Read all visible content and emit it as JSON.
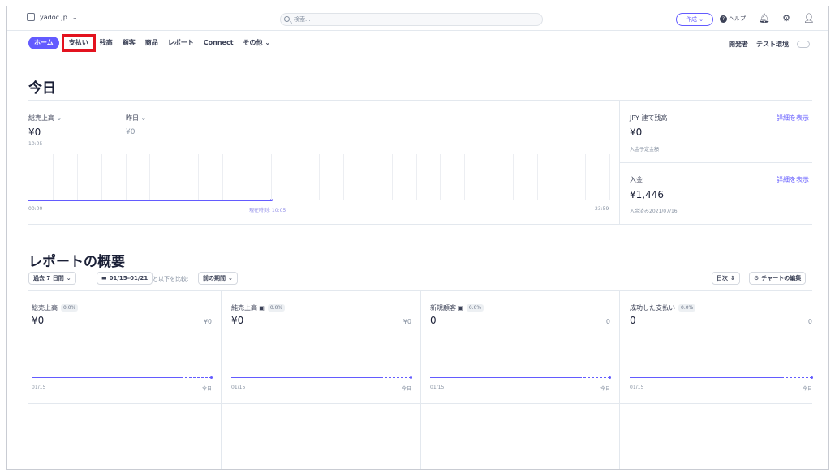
{
  "topbar": {
    "account": "yadoc.jp",
    "search_placeholder": "検索...",
    "create_label": "作成",
    "help_label": "ヘルプ"
  },
  "nav": {
    "items": [
      "ホーム",
      "支払い",
      "残高",
      "顧客",
      "商品",
      "レポート",
      "Connect",
      "その他"
    ],
    "developer": "開発者",
    "test_mode": "テスト環境"
  },
  "today": {
    "title": "今日",
    "gross_label": "総売上高",
    "gross_value": "¥0",
    "gross_time": "10:05",
    "yesterday_label": "昨日",
    "yesterday_value": "¥0",
    "axis_start": "00:00",
    "axis_now": "現在時刻: 10:05",
    "axis_end": "23:59",
    "balance_label": "JPY 建て残高",
    "balance_link": "詳細を表示",
    "balance_value": "¥0",
    "balance_sub": "入金予定金額",
    "payout_label": "入金",
    "payout_link": "詳細を表示",
    "payout_value": "¥1,446",
    "payout_sub": "入金済み2021/07/16"
  },
  "report": {
    "title": "レポートの概要",
    "range_label": "過去 7 日間",
    "dates_label": "01/15–01/21",
    "compare_text": "と以下を比較:",
    "compare_label": "前の期間",
    "interval_label": "日次",
    "edit_label": "チャートの編集",
    "cards": [
      {
        "label": "総売上高",
        "chip": "0.0%",
        "value": "¥0",
        "prev": "¥0",
        "start": "01/15",
        "end": "今日"
      },
      {
        "label": "純売上高",
        "chip": "0.0%",
        "value": "¥0",
        "prev": "¥0",
        "start": "01/15",
        "end": "今日"
      },
      {
        "label": "新規顧客",
        "chip": "0.0%",
        "value": "0",
        "prev": "0",
        "start": "01/15",
        "end": "今日"
      },
      {
        "label": "成功した支払い",
        "chip": "0.0%",
        "value": "0",
        "prev": "0",
        "start": "01/15",
        "end": "今日"
      }
    ]
  },
  "colors": {
    "accent": "#635bff",
    "highlight": "#e3131f"
  }
}
